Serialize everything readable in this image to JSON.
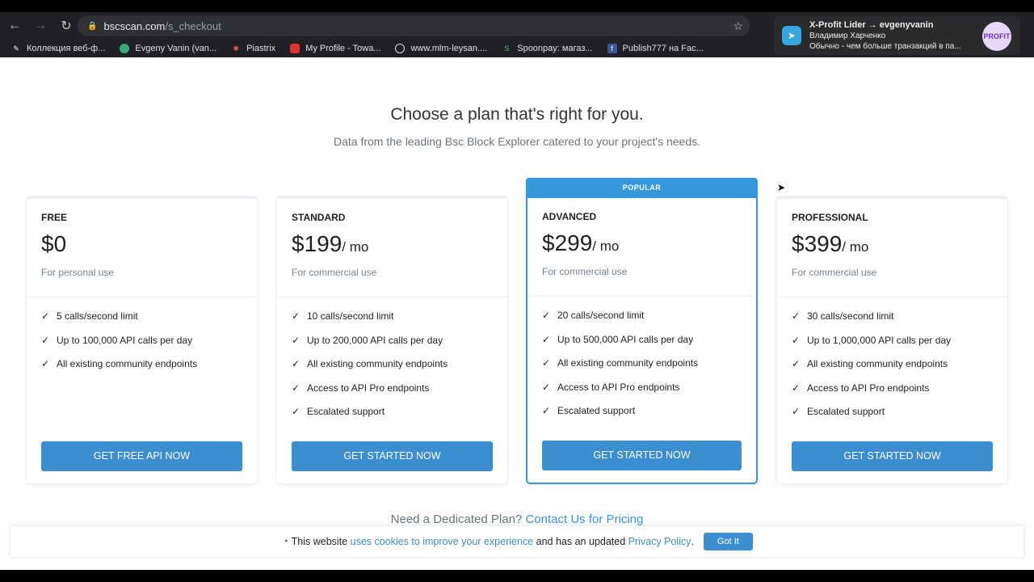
{
  "browser": {
    "url_host": "bscscan.com",
    "url_path": "/s_checkout",
    "bookmarks": [
      "Коллекция веб-ф...",
      "Evgeny Vanin (van...",
      "Piastrix",
      "My Profile - Towa...",
      "www.mlm-leysan....",
      "Spoonpay: магаз...",
      "Publish777 на Fac..."
    ]
  },
  "notification": {
    "title": "X-Profit Lider → evgenyvanin",
    "sender": "Владимир Харченко",
    "message": "Обычно - чем больше транзакций в па...",
    "avatar_text": "PROFIT"
  },
  "page": {
    "title": "Choose a plan that's right for you.",
    "subtitle": "Data from the leading Bsc Block Explorer catered to your project's needs.",
    "plans": [
      {
        "name": "FREE",
        "price": "$0",
        "period": "",
        "use": "For personal use",
        "features": [
          "5 calls/second limit",
          "Up to 100,000 API calls per day",
          "All existing community endpoints"
        ],
        "button": "GET FREE API NOW"
      },
      {
        "name": "STANDARD",
        "price": "$199",
        "period": "/ mo",
        "use": "For commercial use",
        "features": [
          "10 calls/second limit",
          "Up to 200,000 API calls per day",
          "All existing community endpoints",
          "Access to API Pro endpoints",
          "Escalated support"
        ],
        "button": "GET STARTED NOW"
      },
      {
        "name": "ADVANCED",
        "badge": "POPULAR",
        "price": "$299",
        "period": "/ mo",
        "use": "For commercial use",
        "features": [
          "20 calls/second limit",
          "Up to 500,000 API calls per day",
          "All existing community endpoints",
          "Access to API Pro endpoints",
          "Escalated support"
        ],
        "button": "GET STARTED NOW"
      },
      {
        "name": "PROFESSIONAL",
        "price": "$399",
        "period": "/ mo",
        "use": "For commercial use",
        "features": [
          "30 calls/second limit",
          "Up to 1,000,000 API calls per day",
          "All existing community endpoints",
          "Access to API Pro endpoints",
          "Escalated support"
        ],
        "button": "GET STARTED NOW"
      }
    ],
    "dedicated_text": "Need a Dedicated Plan?",
    "dedicated_link": "Contact Us for Pricing"
  },
  "cookie": {
    "text1": "This website",
    "link1": "uses cookies to improve your experience",
    "text2": "and has an updated",
    "link2": "Privacy Policy",
    "text3": ".",
    "button": "Got It"
  },
  "colors": {
    "accent": "#3498db",
    "button": "#3b8fd0"
  }
}
